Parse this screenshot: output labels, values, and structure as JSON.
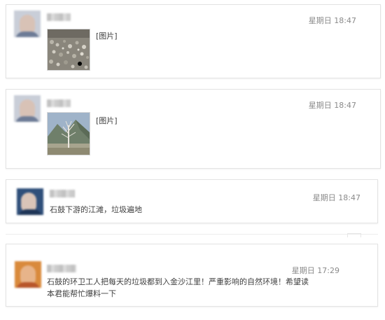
{
  "messages": [
    {
      "timestamp": "星期日 18:47",
      "content": "[图片]",
      "type": "image",
      "image_desc": "rocky riverbank"
    },
    {
      "timestamp": "星期日 18:47",
      "content": "[图片]",
      "type": "image",
      "image_desc": "bare tree by mountain"
    },
    {
      "timestamp": "星期日 18:47",
      "content": "石鼓下游的江滩，垃圾遍地",
      "type": "text"
    },
    {
      "timestamp": "星期日 17:29",
      "content": "石鼓的环卫工人把每天的垃圾都到入金沙江里！严重影响的自然环境！希望读本君能帮忙爆料一下",
      "line1": "石鼓的环卫工人把每天的垃圾都到入金沙江里！严重影响的自然环境！希望读",
      "line2": "本君能帮忙爆料一下",
      "type": "text"
    }
  ],
  "colors": {
    "card_border": "#e3e3e3",
    "timestamp": "#8a8a8a",
    "text": "#404040"
  }
}
